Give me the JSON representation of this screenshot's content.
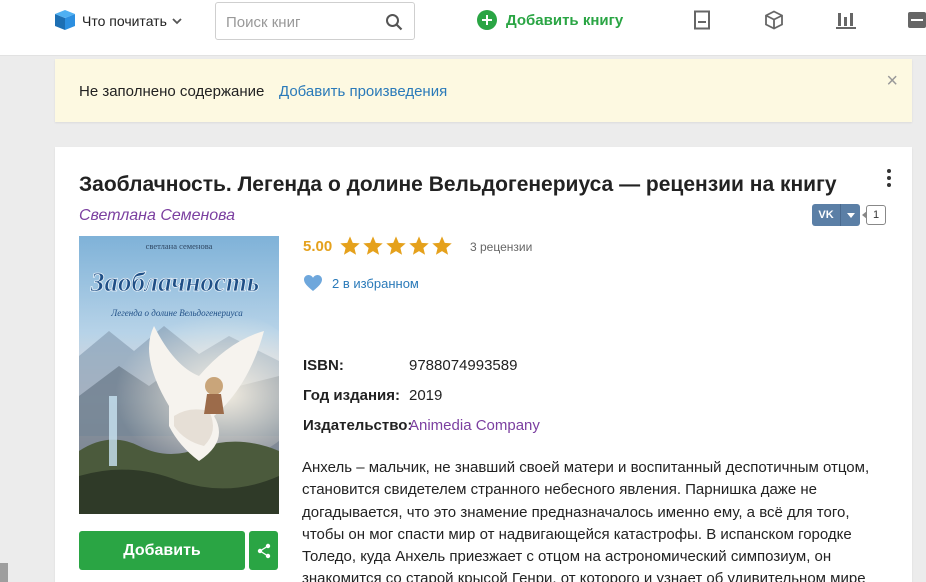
{
  "header": {
    "nav_label": "Что почитать",
    "search_placeholder": "Поиск книг",
    "add_book_label": "Добавить книгу"
  },
  "notice": {
    "text": "Не заполнено содержание",
    "link": "Добавить произведения",
    "close_glyph": "×"
  },
  "book": {
    "title": "Заоблачность. Легенда о долине Вельдогенериуса — рецензии на книгу",
    "author": "Светлана Семенова",
    "rating": "5.00",
    "stars": 5,
    "reviews": "3 рецензии",
    "favorites": "2 в избранном",
    "share_vk_label": "VK",
    "share_count": "1",
    "cover": {
      "author": "светлана семенова",
      "title": "Заоблачность",
      "subtitle": "Легенда о долине Вельдогенериуса"
    },
    "meta": [
      {
        "key": "ISBN:",
        "value": "9788074993589"
      },
      {
        "key": "Год издания:",
        "value": "2019"
      },
      {
        "key": "Издательство:",
        "value": "Animedia Company"
      }
    ],
    "description": "Анхель – мальчик, не знавший своей матери и воспитанный деспотичным отцом, становится свидетелем странного небесного явления. Парнишка даже не догадывается, что это знамение предназначалось именно ему, а всё для того, чтобы он мог спасти мир от надвигающейся катастрофы. В испанском городке Толедо, куда Анхель приезжает с отцом на астрономический симпозиум, он знакомится со старой крысой Генри, от которого и узнает об удивительном мире",
    "add_label": "Добавить"
  },
  "colors": {
    "accent_green": "#2aa544",
    "link_blue": "#2a7ab9",
    "author_purple": "#7b3fa0",
    "rating_orange": "#e5a11c",
    "notice_bg": "#fdf9e1"
  },
  "icons": [
    "book-logo-icon",
    "chevron-down-icon",
    "search-icon",
    "plus-icon",
    "notebook-icon",
    "box-icon",
    "chart-icon",
    "menu-icon",
    "close-icon",
    "more-vertical-icon",
    "vk-icon",
    "star-icon",
    "heart-icon",
    "share-icon"
  ]
}
